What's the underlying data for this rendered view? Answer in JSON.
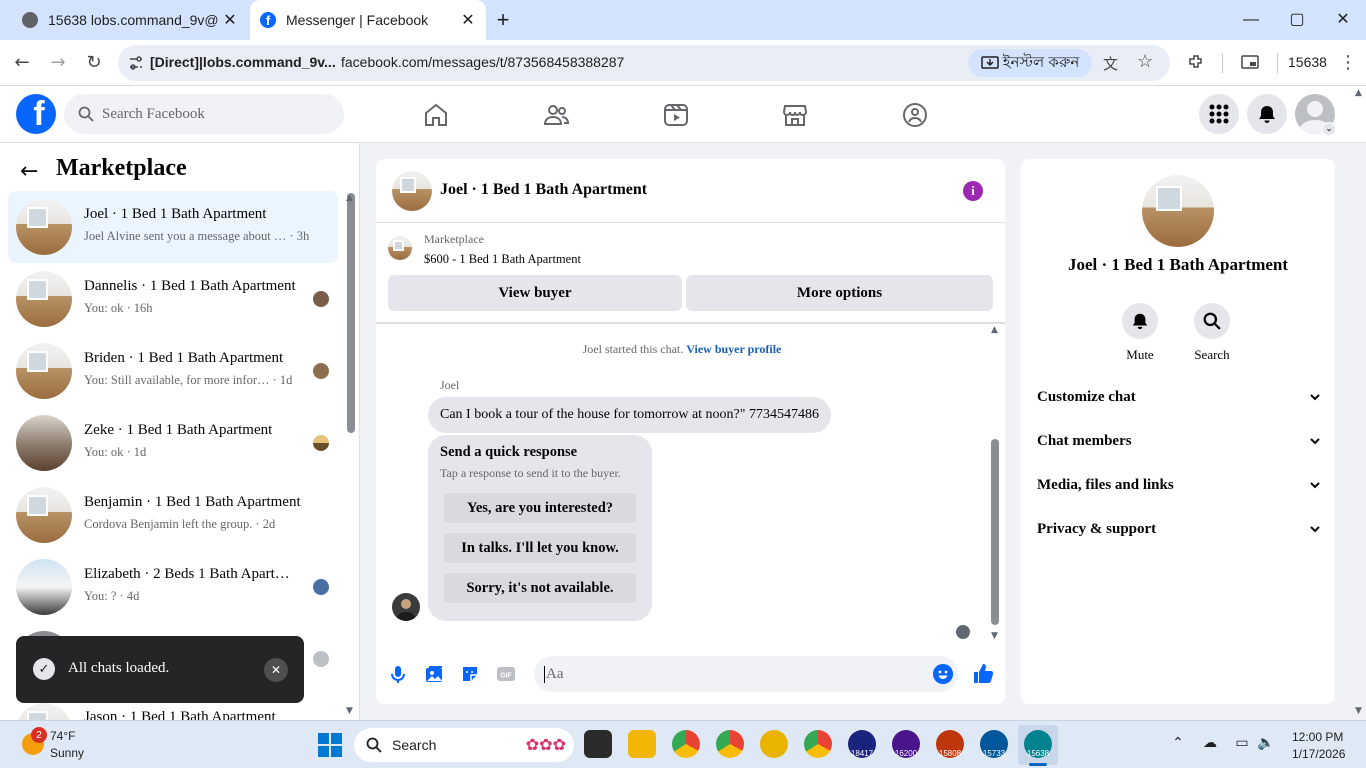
{
  "browser": {
    "tabs": [
      {
        "title": "15638 lobs.command_9v@",
        "active": false
      },
      {
        "title": "Messenger | Facebook",
        "active": true
      }
    ],
    "new_tab": "+",
    "window": {
      "minimize": "—",
      "maximize": "▢",
      "close": "✕"
    },
    "site_label": "[Direct]|lobs.command_9v...",
    "url": "facebook.com/messages/t/873568458388287",
    "install_label": "ইনস্টল করুন",
    "profile": "15638"
  },
  "fb": {
    "search_placeholder": "Search Facebook",
    "brand_color": "#0866ff"
  },
  "sidebar": {
    "title": "Marketplace",
    "conversations": [
      {
        "name": "Joel · 1 Bed 1 Bath Apartment",
        "snippet": "Joel Alvine sent you a message about … · 3h",
        "active": true
      },
      {
        "name": "Dannelis · 1 Bed 1 Bath Apartment",
        "snippet": "You: ok · 16h"
      },
      {
        "name": "Briden · 1 Bed 1 Bath Apartment",
        "snippet": "You: Still available, for more infor… · 1d"
      },
      {
        "name": "Zeke · 1 Bed 1 Bath Apartment",
        "snippet": "You: ok · 1d"
      },
      {
        "name": "Benjamin · 1 Bed 1 Bath Apartment",
        "snippet": "Cordova Benjamin left the group. · 2d"
      },
      {
        "name": "Elizabeth · 2 Beds 1 Bath Apart…",
        "snippet": "You: ? · 4d"
      },
      {
        "name": "Jason · 1 Bed 1 Bath Apartment",
        "snippet": ""
      }
    ]
  },
  "toast": {
    "text": "All chats loaded."
  },
  "chat": {
    "title": "Joel · 1 Bed 1 Bath Apartment",
    "marketplace_label": "Marketplace",
    "listing": "$600 - 1 Bed 1 Bath Apartment",
    "view_buyer": "View buyer",
    "more_options": "More options",
    "started_text": "Joel started this chat.",
    "buyer_profile_link": "View buyer profile",
    "sender_name": "Joel",
    "message": "Can I book a tour of the house for tomorrow at noon?\" 7734547486",
    "quick_title": "Send a quick response",
    "quick_sub": "Tap a response to send it to the buyer.",
    "quick_options": [
      "Yes, are you interested?",
      "In talks. I'll let you know.",
      "Sorry, it's not available."
    ],
    "composer_placeholder": "Aa",
    "info_color": "#9c27b0"
  },
  "info": {
    "title": "Joel · 1 Bed 1 Bath Apartment",
    "actions": [
      {
        "label": "Mute",
        "icon": "bell-icon"
      },
      {
        "label": "Search",
        "icon": "search-icon"
      }
    ],
    "sections": [
      "Customize chat",
      "Chat members",
      "Media, files and links",
      "Privacy & support"
    ]
  },
  "taskbar": {
    "weather_badge": "2",
    "temp": "74°F",
    "condition": "Sunny",
    "search_label": "Search",
    "app_badges": [
      "18417",
      "16200",
      "15808",
      "15733",
      "15638"
    ],
    "time": "12:00 PM",
    "date": "1/17/2026"
  }
}
